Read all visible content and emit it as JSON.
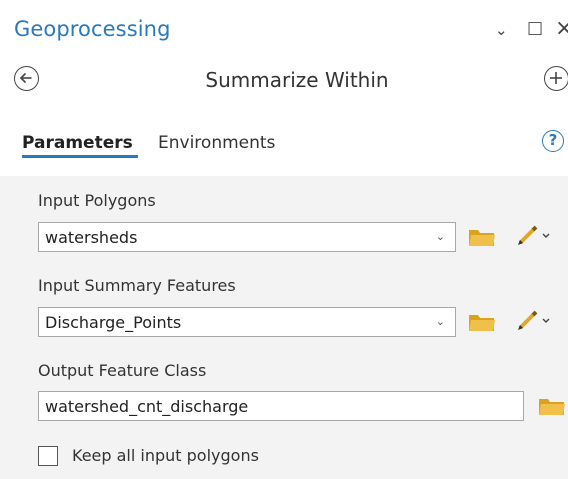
{
  "pane": {
    "title": "Geoprocessing",
    "controls": {
      "dropdown": "⌄",
      "maximize": "□",
      "close": "×"
    }
  },
  "tool": {
    "title": "Summarize Within",
    "back_icon": "back-arrow-icon",
    "add_icon": "add-icon"
  },
  "tabs": [
    {
      "label": "Parameters",
      "active": true
    },
    {
      "label": "Environments",
      "active": false
    }
  ],
  "help_glyph": "?",
  "parameters": {
    "input_polygons": {
      "label": "Input Polygons",
      "value": "watersheds"
    },
    "input_summary_features": {
      "label": "Input Summary Features",
      "value": "Discharge_Points"
    },
    "output_feature_class": {
      "label": "Output Feature Class",
      "value": "watershed_cnt_discharge"
    },
    "keep_all_polygons": {
      "label": "Keep all input polygons",
      "checked": false
    }
  },
  "colors": {
    "accent": "#2a79bf",
    "folder": "#e8b23a",
    "pencil": "#e8b23a",
    "panel_bg": "#f3f3f3"
  }
}
